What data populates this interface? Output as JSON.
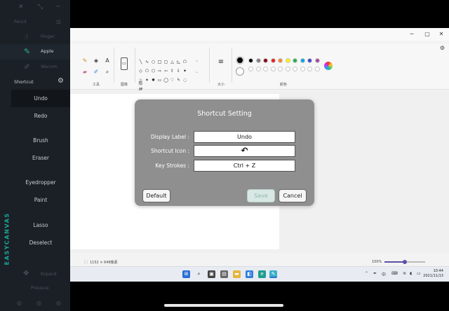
{
  "panel": {
    "top_label": "Pencil",
    "apps": [
      {
        "label": "Finger",
        "active": false
      },
      {
        "label": "Apple",
        "active": true
      },
      {
        "label": "Wacom",
        "active": false
      }
    ],
    "section_title": "Shortcut",
    "shortcuts": [
      "Undo",
      "Redo",
      "Brush",
      "Eraser",
      "Eyedropper",
      "Paint",
      "Lasso",
      "Deselect"
    ],
    "brand": "EASYCANVAS",
    "expand_label": "Expand",
    "pressure_label": "Pressure"
  },
  "paint": {
    "groups": {
      "tools": "工具",
      "image": "图像",
      "shapes": "形状",
      "size": "大小",
      "colors": "颜色"
    },
    "status_size": "1152 × 648像素",
    "zoom": "100%",
    "zoom_fraction": 0.5,
    "colors_row1": [
      "#000000",
      "#7f7f7f",
      "#880015",
      "#ed1c24",
      "#ff7f27",
      "#fff200",
      "#22b14c",
      "#00a2e8",
      "#3f48cc",
      "#a349a4"
    ],
    "colors_row2": [
      "#ffffff",
      "#c3c3c3",
      "#b97a57",
      "#ffaec9",
      "#ffc90e",
      "#efe4b0",
      "#b5e61d",
      "#99d9ea",
      "#7092be",
      "#c8bfe7"
    ]
  },
  "taskbar": {
    "tray_lang": "中",
    "time": "10:44",
    "date": "2021/11/13"
  },
  "dialog": {
    "title": "Shortcut Setting",
    "display_label_label": "Display Label :",
    "display_label_value": "Undo",
    "shortcut_icon_label": "Shortcut Icon :",
    "shortcut_icon_glyph": "↶",
    "key_strokes_label": "Key Strokes :",
    "key_strokes_value": "Ctrl + Z",
    "default_button": "Default",
    "save_button": "Save",
    "cancel_button": "Cancel"
  }
}
